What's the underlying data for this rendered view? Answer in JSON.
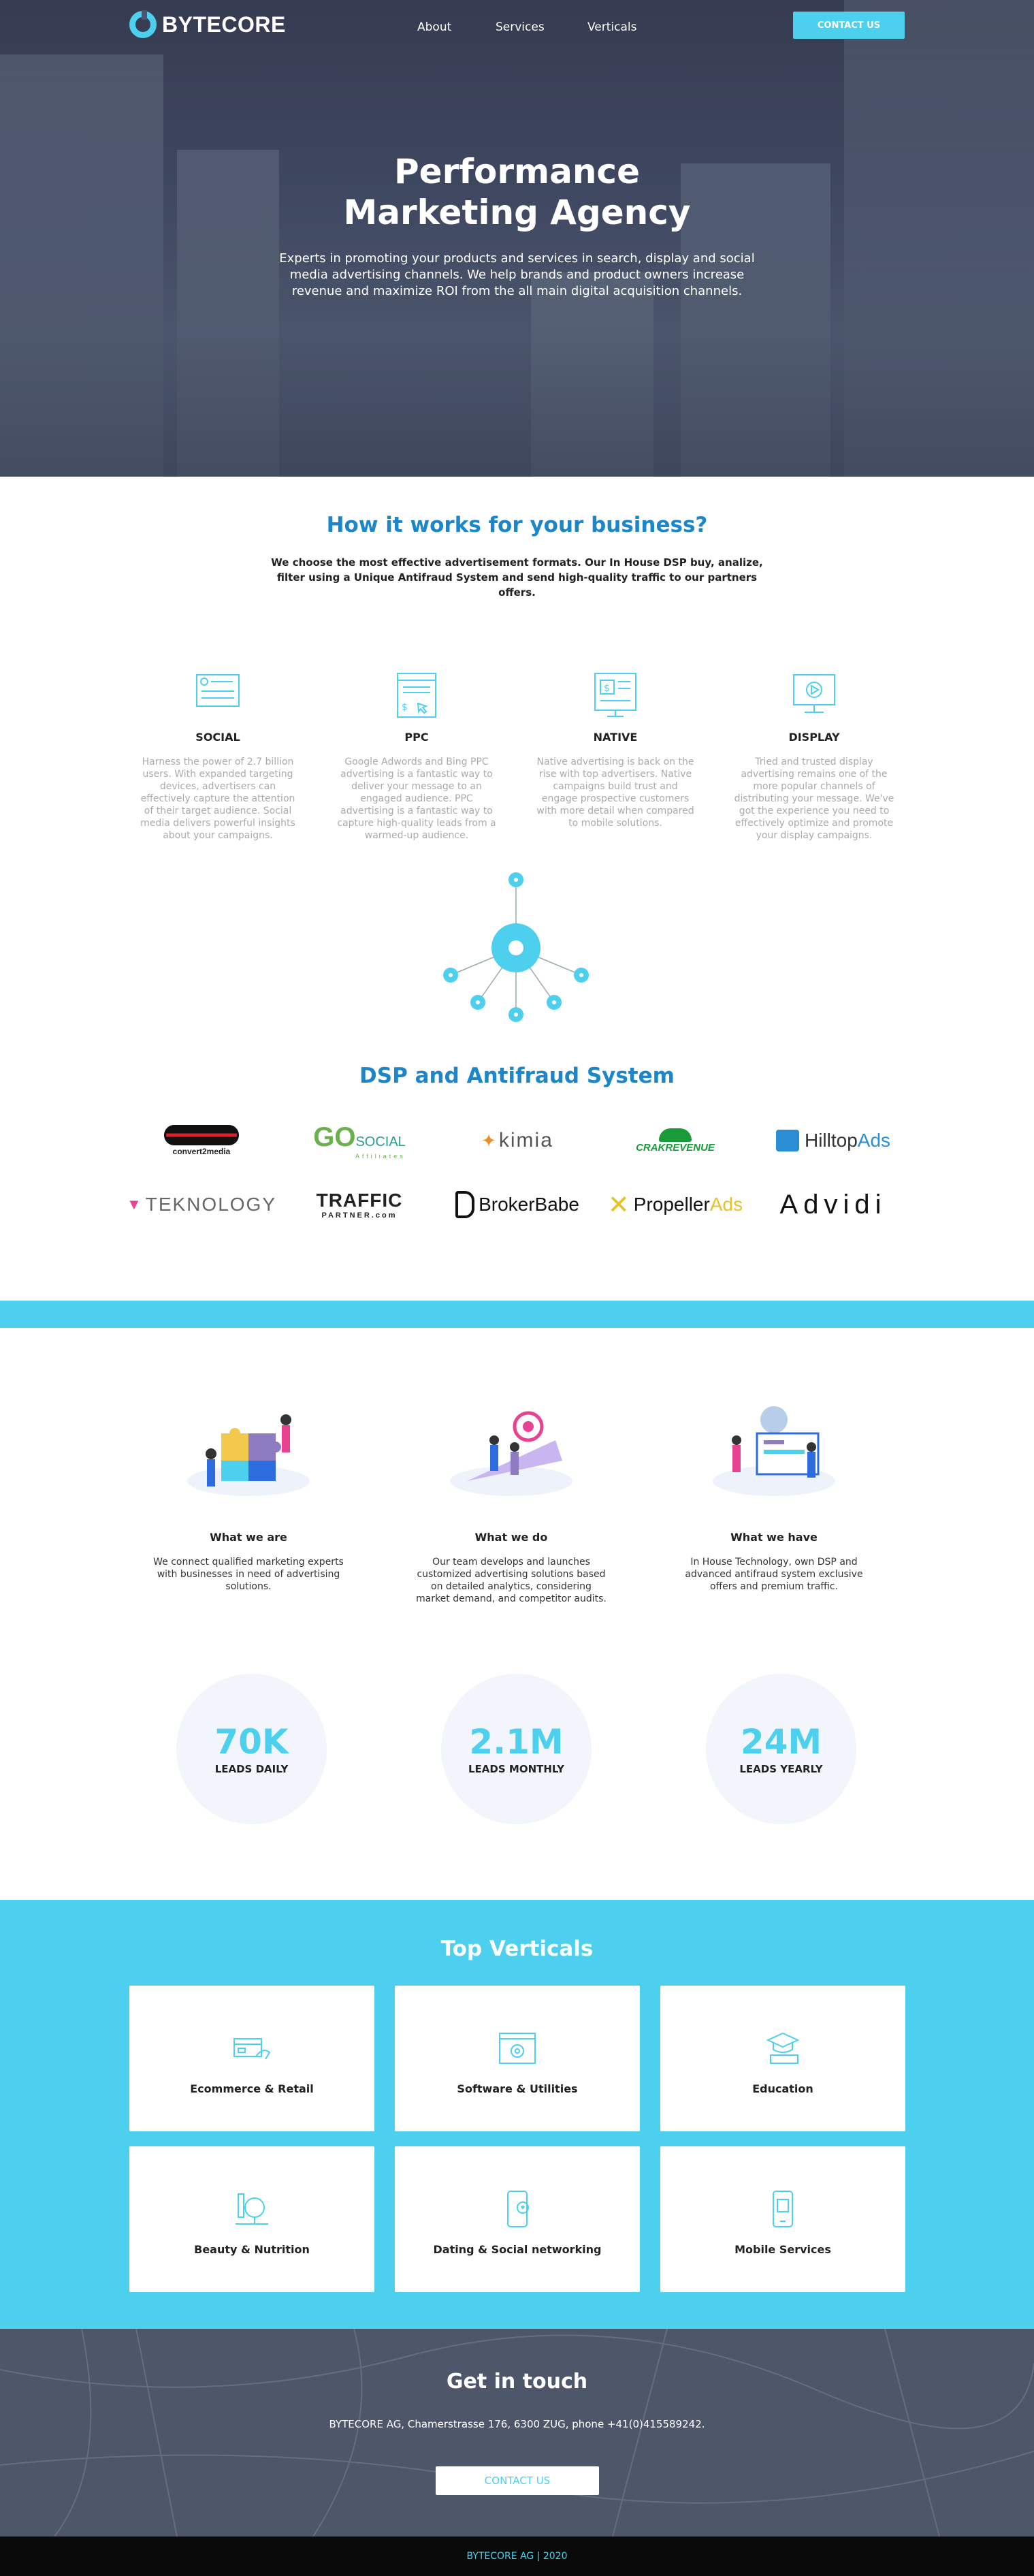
{
  "brand": {
    "name": "BYTECORE",
    "accent": "#4dcfee",
    "title_blue": "#1b86c9"
  },
  "nav": {
    "items": [
      "About",
      "Services",
      "Verticals"
    ],
    "cta": "CONTACT US"
  },
  "hero": {
    "title_line1": "Performance",
    "title_line2": "Marketing Agency",
    "subtitle": "Experts in promoting your products and services in search, display and social media advertising channels. We help brands and product owners increase revenue and maximize ROI from the all main digital acquisition channels."
  },
  "how": {
    "title": "How it works for your business?",
    "lead": "We choose the most effective advertisement formats. Our In House DSP buy, analize, filter using a Unique Antifraud System and send high-quality traffic to our partners offers.",
    "features": [
      {
        "icon": "social-icon",
        "title": "SOCIAL",
        "text": "Harness the power of 2.7 billion users. With expanded targeting devices, advertisers can effectively capture the attention of their target audience. Social media delivers powerful insights about your campaigns."
      },
      {
        "icon": "ppc-icon",
        "title": "PPC",
        "text": "Google Adwords and Bing PPC advertising is a fantastic way to deliver your message to an engaged audience. PPC advertising is a fantastic way to capture high-quality leads from a warmed-up audience."
      },
      {
        "icon": "native-icon",
        "title": "NATIVE",
        "text": "Native advertising is back on the rise with top advertisers. Native campaigns build trust and engage prospective customers with more detail when compared to mobile solutions."
      },
      {
        "icon": "display-icon",
        "title": "DISPLAY",
        "text": "Tried and trusted display advertising remains one of the more popular channels of distributing your message. We've got the experience you need to effectively optimize and promote your display campaigns."
      }
    ]
  },
  "dsp": {
    "title": "DSP and Antifraud System",
    "logos": [
      {
        "name": "convert2media",
        "main": "convert2media",
        "color": "#111"
      },
      {
        "name": "gosocial",
        "main": "GO",
        "sub": "SOCIAL",
        "tag": "Affiliates",
        "color": "#6ab04c"
      },
      {
        "name": "kimia",
        "main": "kimia",
        "color": "#555"
      },
      {
        "name": "crakrevenue",
        "main": "CRAKREVENUE",
        "color": "#1a9b3a"
      },
      {
        "name": "hilltopads",
        "main": "Hilltop",
        "sub": "Ads",
        "color": "#333"
      },
      {
        "name": "teknology",
        "main": "TEKNOLOGY",
        "color": "#666"
      },
      {
        "name": "traffic-partner",
        "main": "TRAFFIC",
        "tag": "PARTNER.com",
        "color": "#111"
      },
      {
        "name": "brokerbabe",
        "main": "BrokerBabe",
        "color": "#111"
      },
      {
        "name": "propellerads",
        "main": "Propeller",
        "sub": "Ads",
        "color": "#111"
      },
      {
        "name": "advidi",
        "main": "Advidi",
        "color": "#111"
      }
    ]
  },
  "about": {
    "cols": [
      {
        "title": "What we are",
        "text": "We connect qualified marketing experts with businesses in need of advertising solutions."
      },
      {
        "title": "What we do",
        "text": "Our team develops and launches customized advertising solutions based on detailed analytics, considering market demand, and competitor audits."
      },
      {
        "title": "What we have",
        "text": "In House Technology, own DSP and advanced antifraud system exclusive offers and premium traffic."
      }
    ],
    "stats": [
      {
        "value": "70K",
        "label": "LEADS DAILY"
      },
      {
        "value": "2.1M",
        "label": "LEADS MONTHLY"
      },
      {
        "value": "24M",
        "label": "LEADS YEARLY"
      }
    ]
  },
  "verticals": {
    "title": "Top Verticals",
    "items": [
      {
        "icon": "card-icon",
        "label": "Ecommerce & Retail"
      },
      {
        "icon": "browser-gear-icon",
        "label": "Software & Utilities"
      },
      {
        "icon": "graduation-cap-icon",
        "label": "Education"
      },
      {
        "icon": "mirror-icon",
        "label": "Beauty & Nutrition"
      },
      {
        "icon": "phone-heart-icon",
        "label": "Dating & Social networking"
      },
      {
        "icon": "mobile-icon",
        "label": "Mobile Services"
      }
    ]
  },
  "contact": {
    "title": "Get in touch",
    "address": "BYTECORE AG, Chamerstrasse 176, 6300 ZUG, phone +41(0)415589242.",
    "button": "CONTACT US"
  },
  "footer": {
    "text": "BYTECORE AG | 2020"
  }
}
